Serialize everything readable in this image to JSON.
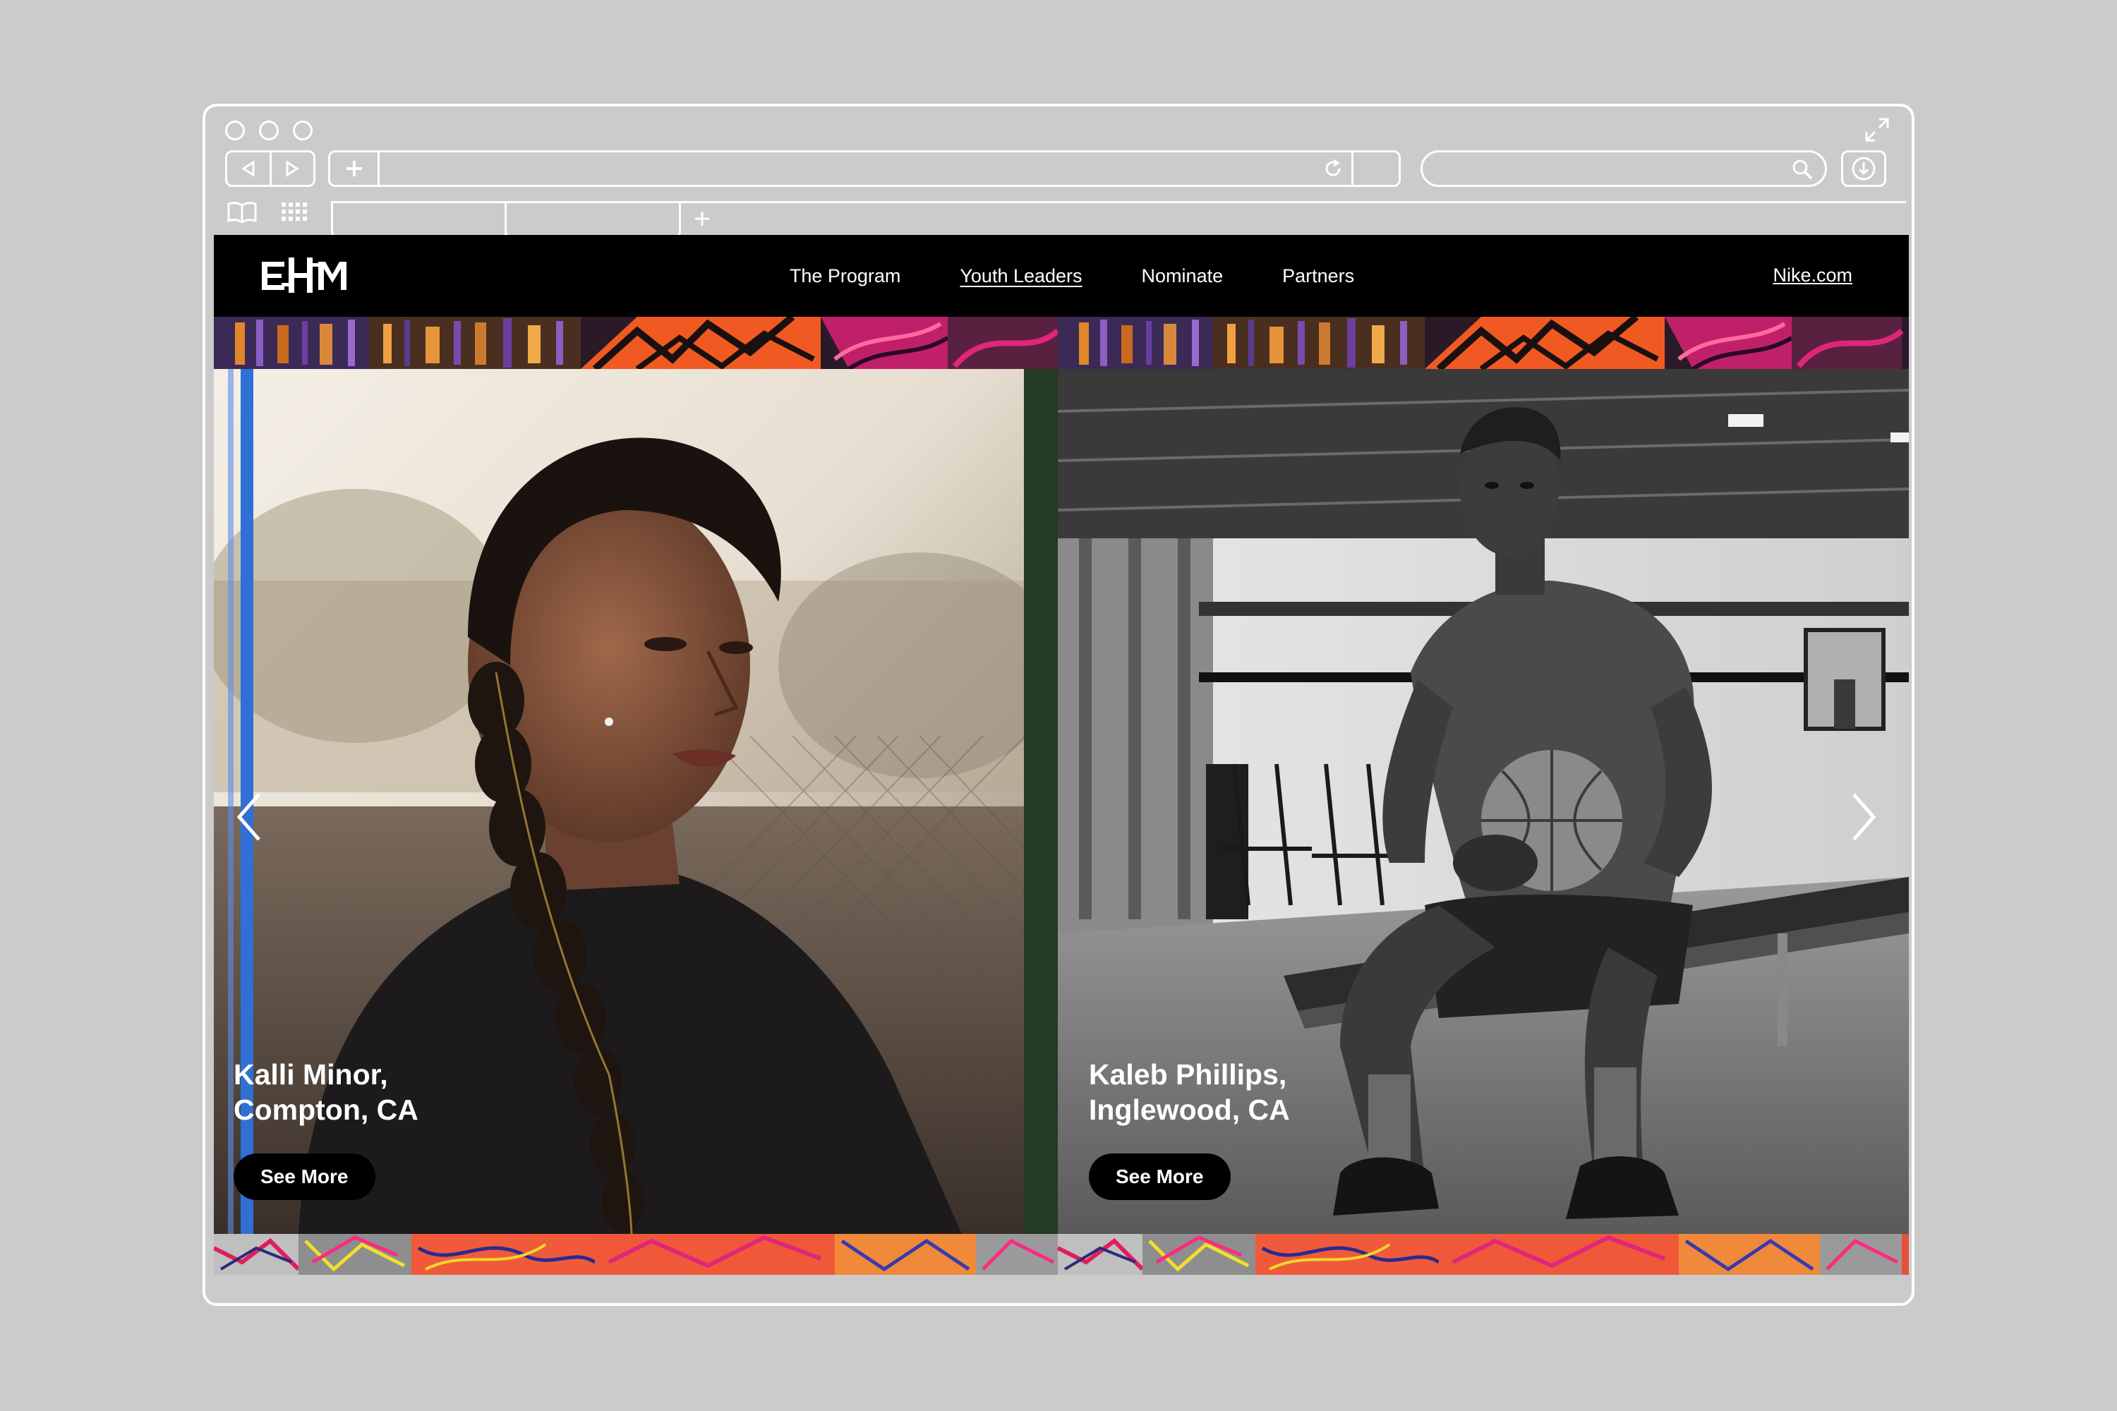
{
  "browser": {
    "url": "",
    "search_placeholder": ""
  },
  "site": {
    "logo_text": "EHM",
    "nav": [
      {
        "label": "The Program"
      },
      {
        "label": "Youth Leaders",
        "active": true
      },
      {
        "label": "Nominate"
      },
      {
        "label": "Partners"
      }
    ],
    "external_link": "Nike.com",
    "colors": {
      "header_bg": "#000000",
      "band_orange": "#f05a22",
      "band_purple": "#6a3fa0",
      "band_magenta": "#e0267a",
      "button_bg": "#000000"
    }
  },
  "carousel": {
    "cards": [
      {
        "name": "Kalli Minor,",
        "location": "Compton, CA",
        "button": "See More"
      },
      {
        "name": "Kaleb Phillips,",
        "location": "Inglewood, CA",
        "button": "See More"
      }
    ],
    "prev_icon": "chevron-left-icon",
    "next_icon": "chevron-right-icon"
  }
}
